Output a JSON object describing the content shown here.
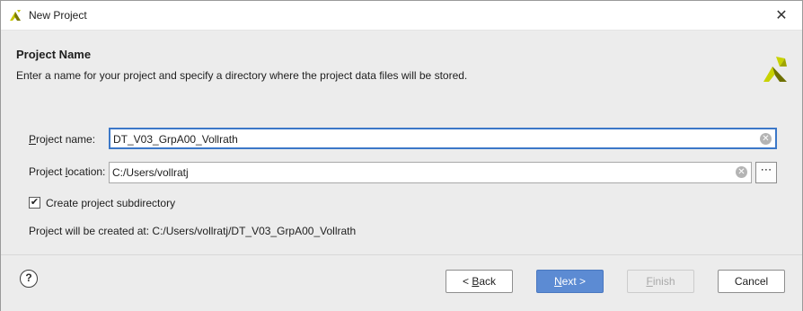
{
  "window": {
    "title": "New Project"
  },
  "header": {
    "title": "Project Name",
    "description": "Enter a name for your project and specify a directory where the project data files will be stored."
  },
  "form": {
    "project_name_label_mn": "P",
    "project_name_label_rest": "roject name:",
    "project_name_value": "DT_V03_GrpA00_Vollrath",
    "project_location_label_pre": "Project ",
    "project_location_label_mn": "l",
    "project_location_label_rest": "ocation:",
    "project_location_value": "C:/Users/vollratj",
    "browse_label": "⋯",
    "create_subdir_label": "Create project subdirectory",
    "create_subdir_checked": true,
    "created_at_text": "Project will be created at: C:/Users/vollratj/DT_V03_GrpA00_Vollrath"
  },
  "footer": {
    "help_label": "?",
    "back_pre": "< ",
    "back_mn": "B",
    "back_rest": "ack",
    "next_mn": "N",
    "next_rest": "ext >",
    "finish_mn": "F",
    "finish_rest": "inish",
    "cancel_label": "Cancel"
  },
  "colors": {
    "accent": "#5c8bd3",
    "focus_border": "#3c78c8",
    "logo_yellow": "#c8d200",
    "logo_dark": "#6e7000"
  },
  "icons": {
    "app": "xilinx-logo-icon",
    "close": "close-icon",
    "clear": "clear-icon",
    "help": "help-icon"
  }
}
